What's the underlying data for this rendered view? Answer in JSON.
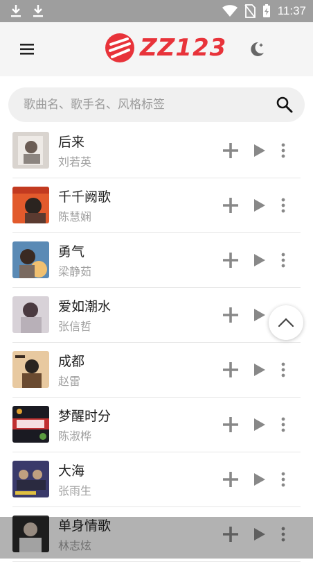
{
  "status": {
    "time": "11:37"
  },
  "header": {
    "logo_text": "ZZ123"
  },
  "search": {
    "placeholder": "歌曲名、歌手名、风格标签"
  },
  "colors": {
    "accent": "#e8333a",
    "icon": "#888888",
    "status_bar": "#9e9e9e"
  },
  "songs": [
    {
      "title": "后来",
      "artist": "刘若英"
    },
    {
      "title": "千千阙歌",
      "artist": "陈慧娴"
    },
    {
      "title": "勇气",
      "artist": "梁静茹"
    },
    {
      "title": "爱如潮水",
      "artist": "张信哲"
    },
    {
      "title": "成都",
      "artist": "赵雷"
    },
    {
      "title": "梦醒时分",
      "artist": "陈淑桦"
    },
    {
      "title": "大海",
      "artist": "张雨生"
    },
    {
      "title": "单身情歌",
      "artist": "林志炫"
    }
  ]
}
